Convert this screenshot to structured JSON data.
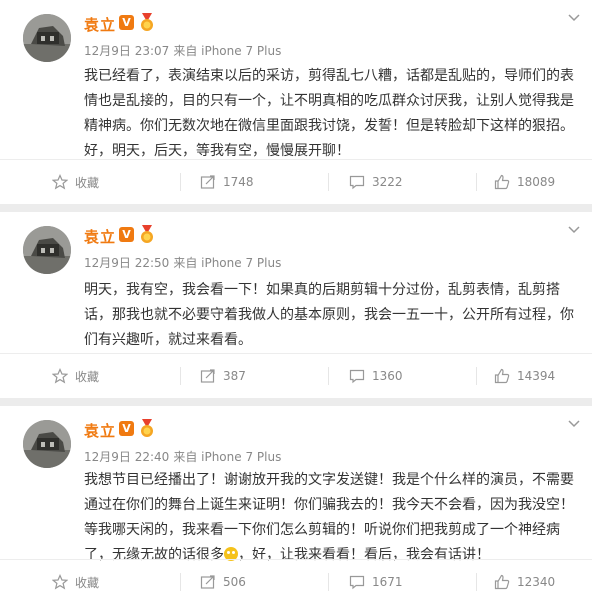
{
  "posts": [
    {
      "author": "袁立",
      "vip_badge": "V",
      "time": "12月9日 23:07",
      "source": "来自 iPhone 7 Plus",
      "lines": [
        "我已经看了，表演结束以后的采访，剪得乱七八糟，话都是乱贴的，导师们的表",
        "情也是乱接的，目的只有一个，让不明真相的吃瓜群众讨厌我，让别人觉得我是",
        "精神病。你们无数次地在微信里面跟我讨饶，发誓！但是转脸却下这样的狠招。",
        "好，明天，后天，等我有空，慢慢展开聊！"
      ],
      "actions": {
        "fav": "收藏",
        "forward": "1748",
        "comment": "3222",
        "like": "18089"
      }
    },
    {
      "author": "袁立",
      "vip_badge": "V",
      "time": "12月9日 22:50",
      "source": "来自 iPhone 7 Plus",
      "lines": [
        "明天，我有空，我会看一下！如果真的后期剪辑十分过份，乱剪表情，乱剪搭",
        "话，那我也就不必要守着我做人的基本原则，我会一五一十，公开所有过程，你",
        "们有兴趣听，就过来看看。"
      ],
      "actions": {
        "fav": "收藏",
        "forward": "387",
        "comment": "1360",
        "like": "14394"
      }
    },
    {
      "author": "袁立",
      "vip_badge": "V",
      "time": "12月9日 22:40",
      "source": "来自 iPhone 7 Plus",
      "lines": [
        "我想节目已经播出了！谢谢放开我的文字发送键！我是个什么样的演员，不需要",
        "通过在你们的舞台上诞生来证明！你们骗我去的！我今天不会看，因为我没空！",
        "等我哪天闲的，我来看一下你们怎么剪辑的！听说你们把我剪成了一个神经病",
        "了，无缘无故的话很多"
      ],
      "line_tail": "，好，让我来看看！看后，我会有话讲！",
      "actions": {
        "fav": "收藏",
        "forward": "506",
        "comment": "1671",
        "like": "12340"
      }
    }
  ],
  "icons": {
    "fav": "star-icon",
    "forward": "forward-icon",
    "comment": "comment-icon",
    "like": "thumbs-up-icon",
    "menu": "chevron-down-icon",
    "medal": "medal-icon",
    "emoji": "laughing-emoji-icon"
  },
  "colors": {
    "name": "#f07a11",
    "text": "#333333",
    "meta": "#888888",
    "background": "#ececec"
  }
}
